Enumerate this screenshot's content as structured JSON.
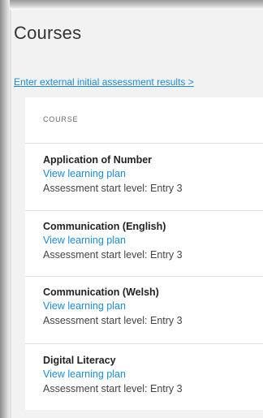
{
  "page": {
    "title": "Courses",
    "external_link": "Enter external initial assessment results >"
  },
  "table": {
    "column_header": "COURSE",
    "rows": [
      {
        "name": "Application of Number",
        "link": "View learning plan",
        "level": "Assessment start level: Entry 3"
      },
      {
        "name": "Communication (English)",
        "link": "View learning plan",
        "level": "Assessment start level: Entry 3"
      },
      {
        "name": "Communication (Welsh)",
        "link": "View learning plan",
        "level": "Assessment start level: Entry 3"
      },
      {
        "name": "Digital Literacy",
        "link": "View learning plan",
        "level": "Assessment start level: Entry 3"
      }
    ]
  },
  "colors": {
    "link": "#1a8cd8",
    "panel_bg": "#f2f2f2",
    "text": "#222222"
  }
}
